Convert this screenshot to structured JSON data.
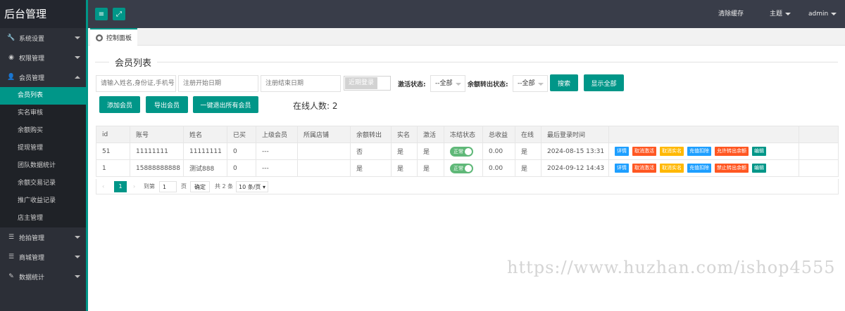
{
  "app_title": "后台管理",
  "sidebar": {
    "items": [
      {
        "label": "系统设置",
        "icon": "wrench-icon"
      },
      {
        "label": "权限管理",
        "icon": "globe-icon"
      },
      {
        "label": "会员管理",
        "icon": "user-icon",
        "expanded": true,
        "children": [
          "会员列表",
          "实名审核",
          "余额购买",
          "提现管理",
          "团队数据统计",
          "余额交易记录",
          "推广收益记录",
          "店主管理"
        ],
        "active_child": "会员列表"
      },
      {
        "label": "抢拍管理",
        "icon": "list-icon"
      },
      {
        "label": "商城管理",
        "icon": "list-icon"
      },
      {
        "label": "数据统计",
        "icon": "leaf-icon"
      }
    ]
  },
  "topbar": {
    "clear_cache": "清除缓存",
    "theme": "主题",
    "user": "admin"
  },
  "tab": {
    "label": "控制面板"
  },
  "page": {
    "title": "会员列表",
    "search_placeholder": "请输入姓名,身份证,手机号",
    "reg_start_placeholder": "注册开始日期",
    "reg_end_placeholder": "注册结束日期",
    "recent_login": "近期登录",
    "activate_label": "激活状态:",
    "activate_value": "--全部",
    "balance_label": "余额转出状态:",
    "balance_value": "--全部",
    "search_btn": "搜索",
    "show_all_btn": "显示全部",
    "add_btn": "添加会员",
    "export_btn": "导出会员",
    "logout_all_btn": "一键退出所有会员",
    "online_count": "在线人数: 2"
  },
  "table": {
    "headers": [
      "id",
      "账号",
      "姓名",
      "已买",
      "上级会员",
      "所属店铺",
      "余额转出",
      "实名",
      "激活",
      "冻结状态",
      "总收益",
      "在线",
      "最后登录时间",
      ""
    ],
    "rows": [
      {
        "id": "51",
        "account": "11111111",
        "name": "11111111",
        "bought": "0",
        "parent": "---",
        "shop": "",
        "transfer": "否",
        "realname": "是",
        "activated": "是",
        "frozen": "正常",
        "income": "0.00",
        "online": "是",
        "last_login": "2024-08-15 13:31",
        "ops": [
          "详情",
          "取消激活",
          "取消实名",
          "充值扣除",
          "允许转出余额",
          "编辑"
        ]
      },
      {
        "id": "1",
        "account": "15888888888",
        "name": "测试888",
        "bought": "0",
        "parent": "---",
        "shop": "",
        "transfer": "是",
        "realname": "是",
        "activated": "是",
        "frozen": "正常",
        "income": "0.00",
        "online": "是",
        "last_login": "2024-09-12 14:43",
        "ops": [
          "详情",
          "取消激活",
          "取消实名",
          "充值扣除",
          "禁止转出余额",
          "编辑"
        ]
      }
    ]
  },
  "pager": {
    "prev": "‹",
    "current": "1",
    "next": "›",
    "goto": "到第",
    "page_input": "1",
    "page_unit": "页",
    "confirm": "确定",
    "total": "共 2 条",
    "per_page": "10 条/页"
  },
  "watermark": "https://www.huzhan.com/ishop4555",
  "colors": {
    "accent": "#009688",
    "sidebar": "#2c2f37",
    "topbar": "#393d49"
  }
}
